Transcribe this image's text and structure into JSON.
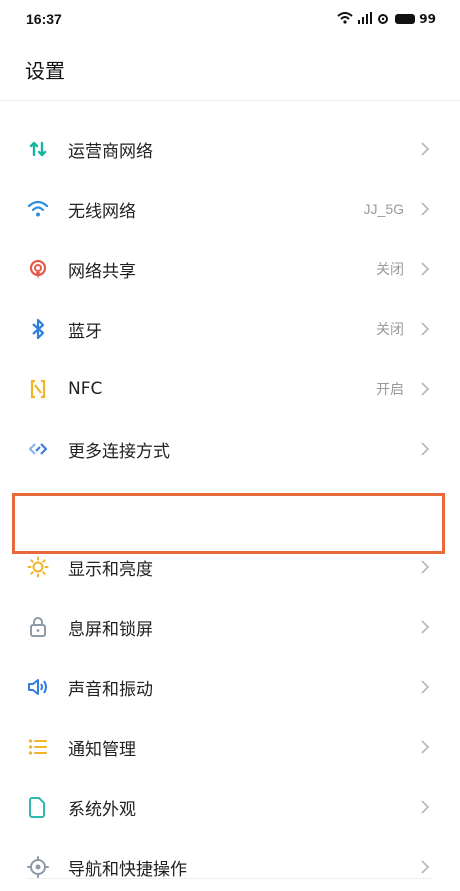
{
  "status_bar": {
    "time": "16:37",
    "battery": "99",
    "icons": [
      "wifi-icon",
      "signal-icon",
      "hotspot-icon",
      "battery-icon"
    ]
  },
  "page": {
    "title": "设置"
  },
  "group1": [
    {
      "label": "运营商网络",
      "value": "",
      "icon": "mobile-data-icon",
      "color": "#18b3a4"
    },
    {
      "label": "无线网络",
      "value": "JJ_5G",
      "icon": "wifi-icon",
      "color": "#2f8fe0"
    },
    {
      "label": "网络共享",
      "value": "关闭",
      "icon": "hotspot-icon",
      "color": "#e55a4a"
    },
    {
      "label": "蓝牙",
      "value": "关闭",
      "icon": "bluetooth-icon",
      "color": "#2f7ee0"
    },
    {
      "label": "NFC",
      "value": "开启",
      "icon": "nfc-icon",
      "color": "#f0b429"
    },
    {
      "label": "更多连接方式",
      "value": "",
      "icon": "link-icon",
      "color": "#3f7fd8"
    }
  ],
  "group2": [
    {
      "label": "显示和亮度",
      "value": "",
      "icon": "brightness-icon",
      "color": "#f0b429",
      "highlighted": true
    },
    {
      "label": "息屏和锁屏",
      "value": "",
      "icon": "lock-icon",
      "color": "#8f9aa8"
    },
    {
      "label": "声音和振动",
      "value": "",
      "icon": "sound-icon",
      "color": "#2f7ee0"
    },
    {
      "label": "通知管理",
      "value": "",
      "icon": "notification-list-icon",
      "color": "#f0b429"
    },
    {
      "label": "系统外观",
      "value": "",
      "icon": "theme-icon",
      "color": "#2fb8b0"
    },
    {
      "label": "导航和快捷操作",
      "value": "",
      "icon": "navigation-icon",
      "color": "#8f9aa8"
    }
  ],
  "highlight_color": "#e86a3a"
}
